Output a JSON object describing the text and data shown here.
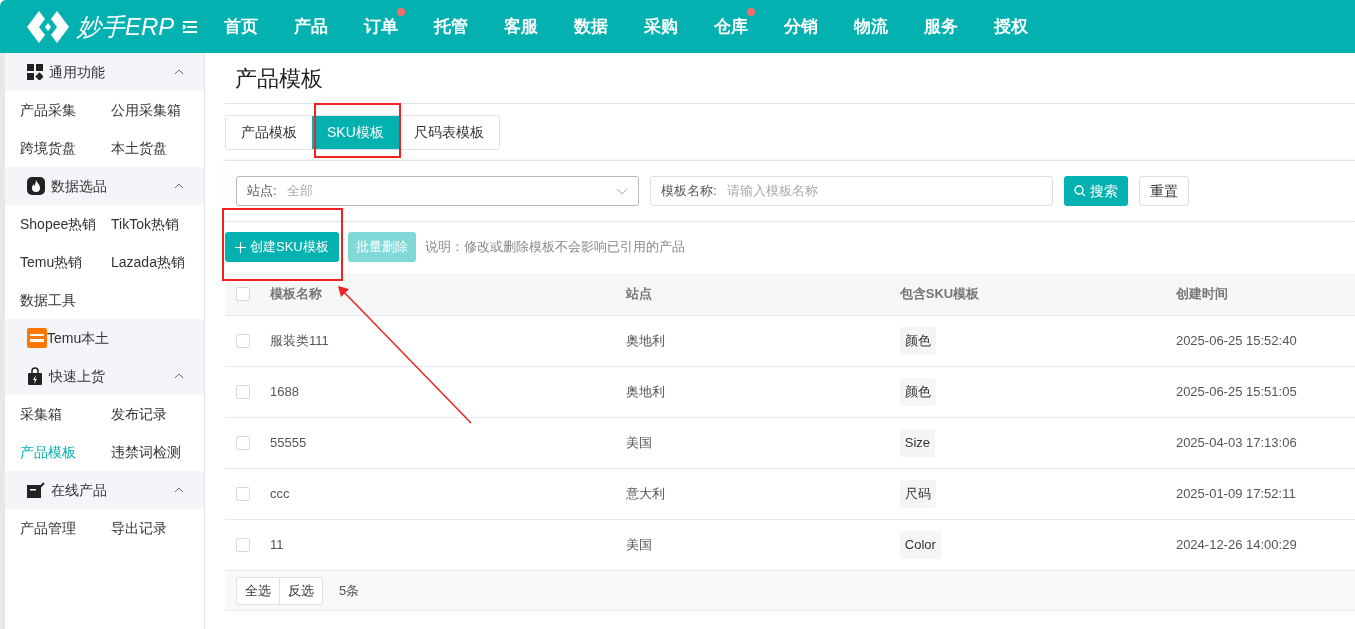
{
  "header": {
    "logo_text": "妙手ERP",
    "nav": [
      {
        "label": "首页"
      },
      {
        "label": "产品"
      },
      {
        "label": "订单",
        "dot": true
      },
      {
        "label": "托管"
      },
      {
        "label": "客服"
      },
      {
        "label": "数据"
      },
      {
        "label": "采购"
      },
      {
        "label": "仓库",
        "dot": true
      },
      {
        "label": "分销"
      },
      {
        "label": "物流"
      },
      {
        "label": "服务"
      },
      {
        "label": "授权"
      }
    ]
  },
  "sidebar": [
    {
      "title": "通用功能",
      "expanded": true,
      "items": [
        {
          "label": "产品采集",
          "selected": false
        },
        {
          "label": "公用采集箱",
          "selected": false
        },
        {
          "label": "跨境货盘",
          "selected": false
        },
        {
          "label": "本土货盘",
          "selected": false
        }
      ]
    },
    {
      "title": "数据选品",
      "expanded": true,
      "items": [
        {
          "label": "Shopee热销",
          "selected": false
        },
        {
          "label": "TikTok热销",
          "selected": false
        },
        {
          "label": "Temu热销",
          "selected": false
        },
        {
          "label": "Lazada热销",
          "selected": false
        },
        {
          "label": "数据工具",
          "selected": false
        }
      ]
    },
    {
      "title": "Temu本土"
    },
    {
      "title": "快速上货",
      "expanded": true,
      "items": [
        {
          "label": "采集箱",
          "selected": false
        },
        {
          "label": "发布记录",
          "selected": false
        },
        {
          "label": "产品模板",
          "selected": true
        },
        {
          "label": "违禁词检测",
          "selected": false
        }
      ]
    },
    {
      "title": "在线产品",
      "expanded": true,
      "items": [
        {
          "label": "产品管理",
          "selected": false
        },
        {
          "label": "导出记录",
          "selected": false
        }
      ]
    }
  ],
  "page_title": "产品模板",
  "tabs": [
    {
      "label": "产品模板",
      "selected": false
    },
    {
      "label": "SKU模板",
      "selected": true
    },
    {
      "label": "尺码表模板",
      "selected": false
    }
  ],
  "filters": {
    "site": {
      "label": "站点:",
      "value": "全部"
    },
    "name": {
      "label": "模板名称:",
      "placeholder": "请输入模板名称"
    },
    "search_button": "搜索",
    "reset_button": "重置"
  },
  "actions": {
    "create_button": "创建SKU模板",
    "delete_button": {
      "label": "批量删除",
      "disabled": true
    },
    "note": "说明：修改或删除模板不会影响已引用的产品"
  },
  "table": {
    "columns": [
      "模板名称",
      "站点",
      "包含SKU模板",
      "创建时间"
    ],
    "all_checked": false,
    "rows": [
      {
        "checked": false,
        "cells": [
          "服装类111",
          "奥地利",
          "颜色",
          "2025-06-25 15:52:40"
        ]
      },
      {
        "checked": false,
        "cells": [
          "1688",
          "奥地利",
          "颜色",
          "2025-06-25 15:51:05"
        ]
      },
      {
        "checked": false,
        "cells": [
          "55555",
          "美国",
          "Size",
          "2025-04-03 17:13:06"
        ]
      },
      {
        "checked": false,
        "cells": [
          "ccc",
          "意大利",
          "尺码",
          "2025-01-09 17:52:11"
        ]
      },
      {
        "checked": false,
        "cells": [
          "11",
          "美国",
          "Color",
          "2024-12-26 14:00:29"
        ]
      }
    ]
  },
  "footer": {
    "select_all": "全选",
    "invert": "反选",
    "count": "5条"
  }
}
